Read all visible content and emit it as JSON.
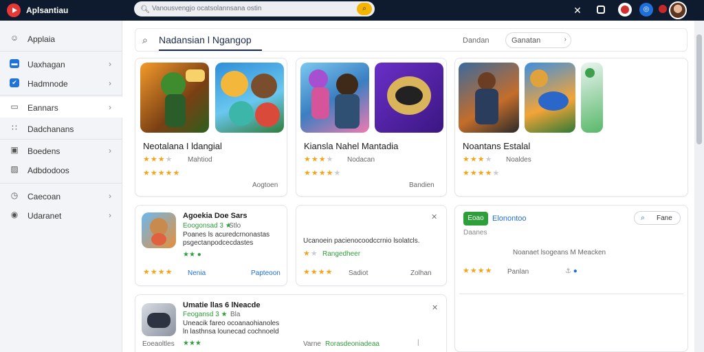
{
  "app": {
    "title": "Aplsantiau",
    "search_placeholder": "Vanousvengjo ocatsolannsana ostin"
  },
  "sidebar": {
    "items": [
      {
        "label": "Applaia",
        "icon": "user-icon"
      },
      {
        "label": "Uaxhagan",
        "icon": "mail-icon"
      },
      {
        "label": "Hadmnode",
        "icon": "chat-icon"
      },
      {
        "label": "Eannars",
        "icon": "folder-icon"
      },
      {
        "label": "Dadchanans",
        "icon": "sliders-icon"
      },
      {
        "label": "Boedens",
        "icon": "briefcase-icon"
      },
      {
        "label": "Adbdodoos",
        "icon": "image-icon"
      },
      {
        "label": "Caecoan",
        "icon": "clock-icon"
      },
      {
        "label": "Udaranet",
        "icon": "circle-icon"
      }
    ]
  },
  "search": {
    "query": "Nadansian l Ngangop",
    "filter_label": "Dandan",
    "sort_value": "Ganatan"
  },
  "featured": [
    {
      "title": "Neotalana I ldangial",
      "meta": "Mahtiod",
      "action": "Aogtoen",
      "rating": 3,
      "rating2": 5
    },
    {
      "title": "Kiansla Nahel Mantadia",
      "meta": "Nodacan",
      "action": "Bandien",
      "rating": 3,
      "rating2": 4
    },
    {
      "title": "Noantans Estalal",
      "meta": "Noaldes",
      "action": "",
      "rating": 3,
      "rating2": 4
    }
  ],
  "list_a": {
    "title": "Agoekia Doe Sars",
    "tag": "Eoogonsad 3 ★",
    "tag2": "Stlo",
    "desc1": "Poanes ls acuredcrnonastas",
    "desc2": "psgectanpodcecdastes",
    "chip": "★★ ●",
    "rating": 4,
    "link1": "Nenia",
    "link2": "Papteoon"
  },
  "list_b": {
    "desc": "Ucanoein pacienocoodccrnio lsolatcls.",
    "tag": "Rangedheer",
    "rating": 4,
    "meta": "Sadiot",
    "right": "Zolhan"
  },
  "list_c": {
    "badge": "Eoao",
    "title": "Elonontoo",
    "sub": "Daanes",
    "desc": "Noanaet lsogeans M Meacken",
    "rating": 4,
    "meta": "Panlan",
    "fav_label": "Fane"
  },
  "list_d": {
    "title": "Umatie llas 6 lNeacde",
    "tag": "Feogansd 3 ★",
    "tag2": "Bla",
    "desc1": "Uneacik fareo ocoanaohianoles",
    "desc2": "ln lasthnsa lounecad cochnoeld",
    "side": "Eoeaoltles",
    "chip": "★★★",
    "foot_label": "Varne",
    "foot_link": "Rorasdeoniadeaa"
  }
}
